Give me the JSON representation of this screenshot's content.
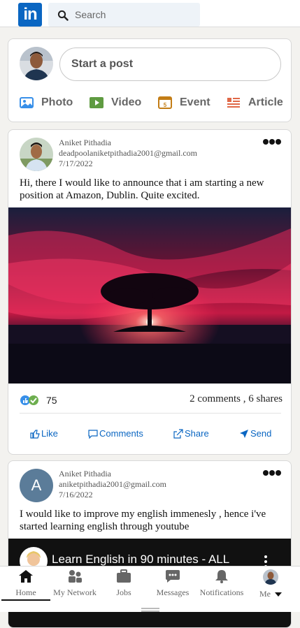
{
  "header": {
    "logo_text": "in",
    "search_placeholder": "Search"
  },
  "composer": {
    "start_post": "Start a post",
    "actions": [
      {
        "label": "Photo",
        "icon": "photo-icon",
        "color": "#378fe9"
      },
      {
        "label": "Video",
        "icon": "video-icon",
        "color": "#5f9b41"
      },
      {
        "label": "Event",
        "icon": "event-icon",
        "color": "#c37d16"
      },
      {
        "label": "Article",
        "icon": "article-icon",
        "color": "#e06847"
      }
    ]
  },
  "posts": [
    {
      "author": "Aniket Pithadia",
      "email": "deadpoolaniketpithadia2001@gmail.com",
      "date": "7/17/2022",
      "text": "Hi, there I would like to announce that i am starting a new position at Amazon, Dublin. Quite excited.",
      "reactions_count": "75",
      "engagement": "2 comments , 6 shares",
      "buttons": [
        "Like",
        "Comments",
        "Share",
        "Send"
      ]
    },
    {
      "author": "Aniket Pithadia",
      "email": "aniketpithadia2001@gmail.com",
      "date": "7/16/2022",
      "avatar_letter": "A",
      "text": "I would like to improve my english immenesly , hence i've started learning english through youtube",
      "video_title": "Learn English in 90 minutes - ALL"
    }
  ],
  "nav": [
    {
      "label": "Home",
      "icon": "home-icon"
    },
    {
      "label": "My Network",
      "icon": "network-icon"
    },
    {
      "label": "Jobs",
      "icon": "jobs-icon"
    },
    {
      "label": "Messages",
      "icon": "messages-icon"
    },
    {
      "label": "Notifications",
      "icon": "notifications-icon"
    },
    {
      "label": "Me",
      "icon": "me-avatar"
    }
  ],
  "colors": {
    "brand": "#0a66c2",
    "background": "#f3f2ef"
  }
}
